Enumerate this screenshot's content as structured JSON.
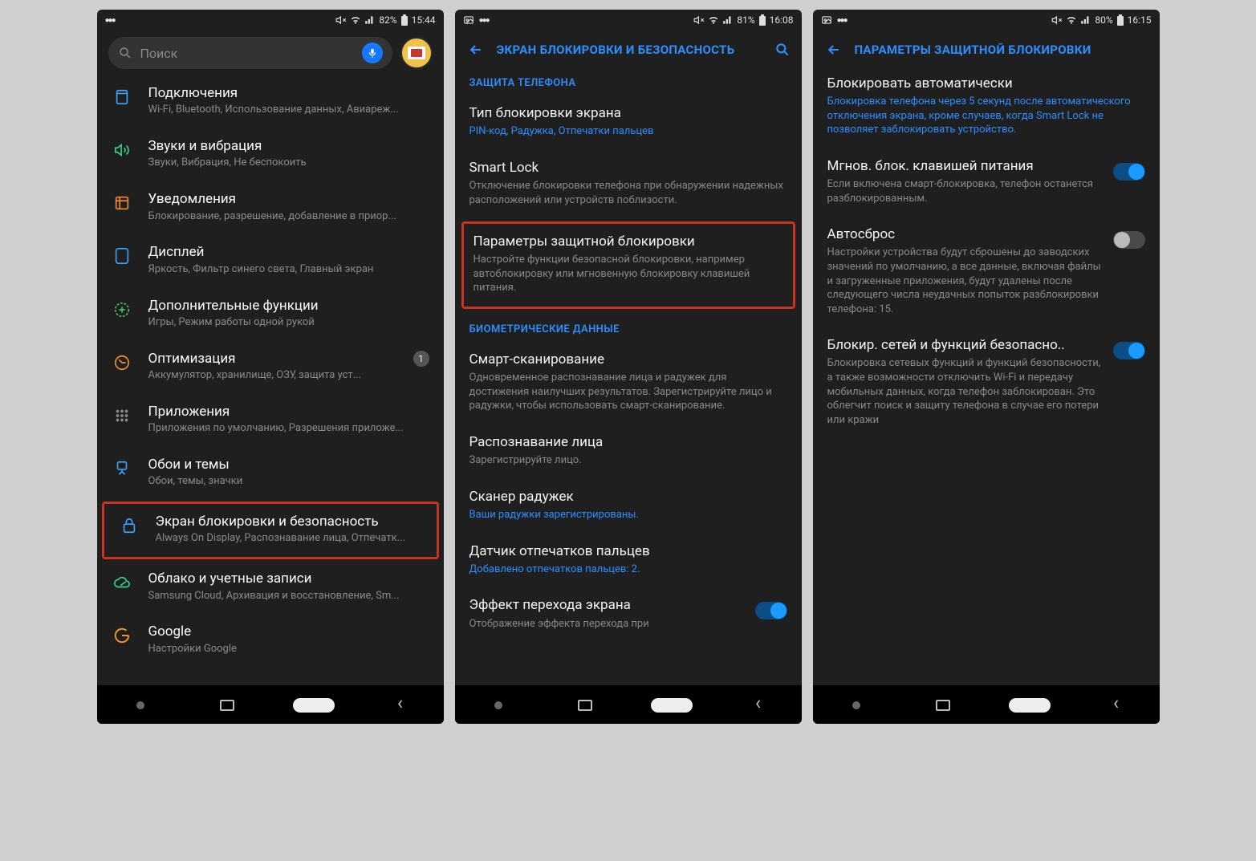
{
  "screen1": {
    "status": {
      "battery": "82%",
      "time": "15:44"
    },
    "search_placeholder": "Поиск",
    "items": [
      {
        "icon": "connections",
        "title": "Подключения",
        "sub": "Wi-Fi, Bluetooth, Использование данных, Авиареж..."
      },
      {
        "icon": "sound",
        "title": "Звуки и вибрация",
        "sub": "Звуки, Вибрация, Не беспокоить"
      },
      {
        "icon": "notify",
        "title": "Уведомления",
        "sub": "Блокирование, разрешение, добавление в приор..."
      },
      {
        "icon": "display",
        "title": "Дисплей",
        "sub": "Яркость, Фильтр синего света, Главный экран"
      },
      {
        "icon": "plus",
        "title": "Дополнительные функции",
        "sub": "Игры, Режим работы одной рукой"
      },
      {
        "icon": "optimize",
        "title": "Оптимизация",
        "sub": "Аккумулятор, хранилище, ОЗУ, защита уст...",
        "badge": "1"
      },
      {
        "icon": "apps",
        "title": "Приложения",
        "sub": "Приложения по умолчанию, Разрешения приложе..."
      },
      {
        "icon": "wallpaper",
        "title": "Обои и темы",
        "sub": "Обои, темы, значки"
      },
      {
        "icon": "lock",
        "title": "Экран блокировки и безопасность",
        "sub": "Always On Display, Распознавание лица, Отпечатк...",
        "highlight": true
      },
      {
        "icon": "cloud",
        "title": "Облако и учетные записи",
        "sub": "Samsung Cloud, Архивация и восстановление, Sm..."
      },
      {
        "icon": "google",
        "title": "Google",
        "sub": "Настройки Google"
      }
    ]
  },
  "screen2": {
    "status": {
      "battery": "81%",
      "time": "16:08"
    },
    "header": "ЭКРАН БЛОКИРОВКИ И БЕЗОПАСНОСТЬ",
    "section1": "ЗАЩИТА ТЕЛЕФОНА",
    "rows1": [
      {
        "t": "Тип блокировки экрана",
        "d": "PIN-код, Радужка, Отпечатки пальцев",
        "link": true
      },
      {
        "t": "Smart Lock",
        "d": "Отключение блокировки телефона при обнаружении надежных расположений или устройств поблизости."
      },
      {
        "t": "Параметры защитной блокировки",
        "d": "Настройте функции безопасной блокировки, например автоблокировку или мгновенную блокировку клавишей питания.",
        "highlight": true
      }
    ],
    "section2": "БИОМЕТРИЧЕСКИЕ ДАННЫЕ",
    "rows2": [
      {
        "t": "Смарт-сканирование",
        "d": "Одновременное распознавание лица и радужек для достижения наилучших результатов. Зарегистрируйте лицо и радужки, чтобы использовать смарт-сканирование."
      },
      {
        "t": "Распознавание лица",
        "d": "Зарегистрируйте лицо."
      },
      {
        "t": "Сканер радужек",
        "d": "Ваши радужки зарегистрированы.",
        "link": true
      },
      {
        "t": "Датчик отпечатков пальцев",
        "d": "Добавлено отпечатков пальцев: 2.",
        "link": true
      },
      {
        "t": "Эффект перехода экрана",
        "d": "Отображение эффекта перехода при",
        "toggle": "on"
      }
    ]
  },
  "screen3": {
    "status": {
      "battery": "80%",
      "time": "16:15"
    },
    "header": "ПАРАМЕТРЫ ЗАЩИТНОЙ БЛОКИРОВКИ",
    "rows": [
      {
        "t": "Блокировать автоматически",
        "d": "Блокировка телефона через 5 секунд после автоматического отключения экрана, кроме случаев, когда Smart Lock не позволяет заблокировать устройство.",
        "link": true
      },
      {
        "t": "Мгнов. блок. клавишей питания",
        "d": "Если включена смарт-блокировка, телефон останется разблокированным.",
        "toggle": "on"
      },
      {
        "t": "Автосброс",
        "d": "Настройки устройства будут сброшены до заводских значений по умолчанию, а все данные, включая файлы и загруженные приложения, будут удалены после следующего числа неудачных попыток разблокировки телефона: 15.",
        "toggle": "off"
      },
      {
        "t": "Блокир. сетей и функций безопасно..",
        "d": "Блокировка сетевых функций и функций безопасности, а также возможности отключить Wi-Fi и передачу мобильных данных, когда телефон заблокирован. Это облегчит поиск и защиту телефона в случае его потери или кражи",
        "toggle": "on"
      }
    ]
  },
  "icons": {
    "connections": "#3aa3ff",
    "sound": "#3ad08a",
    "notify": "#f08a3a",
    "display": "#3aa3ff",
    "plus": "#4ac06a",
    "optimize": "#f09030",
    "apps": "#8a8a8a",
    "wallpaper": "#3aa3ff",
    "lock": "#3aa3ff",
    "cloud": "#3ad08a",
    "google": "#f09030"
  }
}
